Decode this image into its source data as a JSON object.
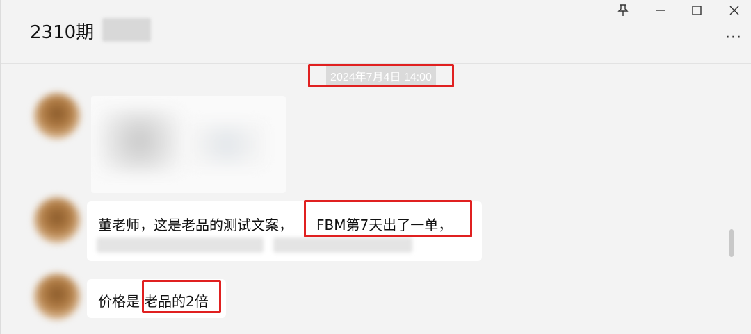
{
  "window": {
    "title": "2310期",
    "controls": {
      "pin_icon": "pin-icon",
      "minimize_icon": "minimize-icon",
      "maximize_icon": "maximize-icon",
      "close_icon": "close-icon"
    },
    "more_label": "···"
  },
  "chat": {
    "timestamp": "2024年7月4日 14:00",
    "messages": [
      {
        "type": "image"
      },
      {
        "type": "text",
        "line1_a": "董老师，这是老品的测试文案，",
        "line1_b": "FBM第7天出了一单，"
      },
      {
        "type": "text",
        "text_a": "价格是",
        "text_b": "老品的2倍"
      }
    ]
  },
  "colors": {
    "highlight": "#e02020",
    "bubble": "#ffffff",
    "background": "#f3f3f3"
  }
}
